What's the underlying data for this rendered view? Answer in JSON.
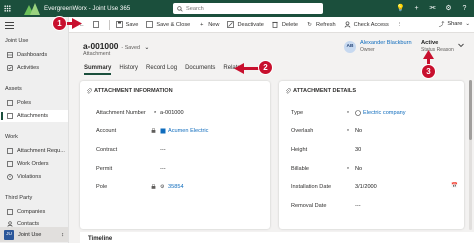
{
  "app": {
    "brand": "EvergreenWorx",
    "title": "EvergreenWorx - Joint Use 365",
    "search_placeholder": "Search",
    "accent": "#1b4f3c"
  },
  "nav": {
    "area_title": "Joint Use",
    "groups": [
      {
        "label": "Assets",
        "items": [
          {
            "label": "Poles",
            "icon": "pole-icon"
          },
          {
            "label": "Attachments",
            "icon": "attachment-icon",
            "active": true
          }
        ]
      },
      {
        "label": "Work",
        "items": [
          {
            "label": "Attachment Requ...",
            "icon": "request-icon"
          },
          {
            "label": "Work Orders",
            "icon": "workorder-icon"
          },
          {
            "label": "Violations",
            "icon": "violation-icon"
          }
        ]
      },
      {
        "label": "Third Party",
        "items": [
          {
            "label": "Companies",
            "icon": "company-icon"
          },
          {
            "label": "Contacts",
            "icon": "contact-icon"
          }
        ]
      }
    ],
    "top_items": [
      {
        "label": "Dashboards",
        "icon": "dashboard-icon"
      },
      {
        "label": "Activities",
        "icon": "activity-icon"
      }
    ],
    "area_switch": {
      "badge": "JU",
      "label": "Joint Use"
    }
  },
  "commands": {
    "save": "Save",
    "save_close": "Save & Close",
    "new": "New",
    "deactivate": "Deactivate",
    "delete": "Delete",
    "refresh": "Refresh",
    "check_access": "Check Access",
    "share": "Share"
  },
  "record": {
    "title": "a-001000",
    "saved_state": "- Saved",
    "entity": "Attachment",
    "owner_initials": "AB",
    "owner_name": "Alexander Blackburn",
    "owner_label": "Owner",
    "status_value": "Active",
    "status_label": "Status Reason"
  },
  "tabs": [
    "Summary",
    "History",
    "Record Log",
    "Documents",
    "Related"
  ],
  "attachment_info": {
    "title": "ATTACHMENT INFORMATION",
    "rows": [
      {
        "label": "Attachment Number",
        "value": "a-001000"
      },
      {
        "label": "Account",
        "value": "Acumen Electric"
      },
      {
        "label": "Contract",
        "value": "---"
      },
      {
        "label": "Permit",
        "value": "---"
      },
      {
        "label": "Pole",
        "value": "35854"
      }
    ]
  },
  "attachment_details": {
    "title": "ATTACHMENT DETAILS",
    "rows": [
      {
        "label": "Type",
        "value": "Electric company"
      },
      {
        "label": "Overlash",
        "value": "No"
      },
      {
        "label": "Height",
        "value": "30"
      },
      {
        "label": "Billable",
        "value": "No"
      },
      {
        "label": "Installation Date",
        "value": "3/1/2000"
      },
      {
        "label": "Removal Date",
        "value": "---"
      }
    ]
  },
  "timeline": "Timeline",
  "callouts": [
    "1",
    "2",
    "3"
  ]
}
